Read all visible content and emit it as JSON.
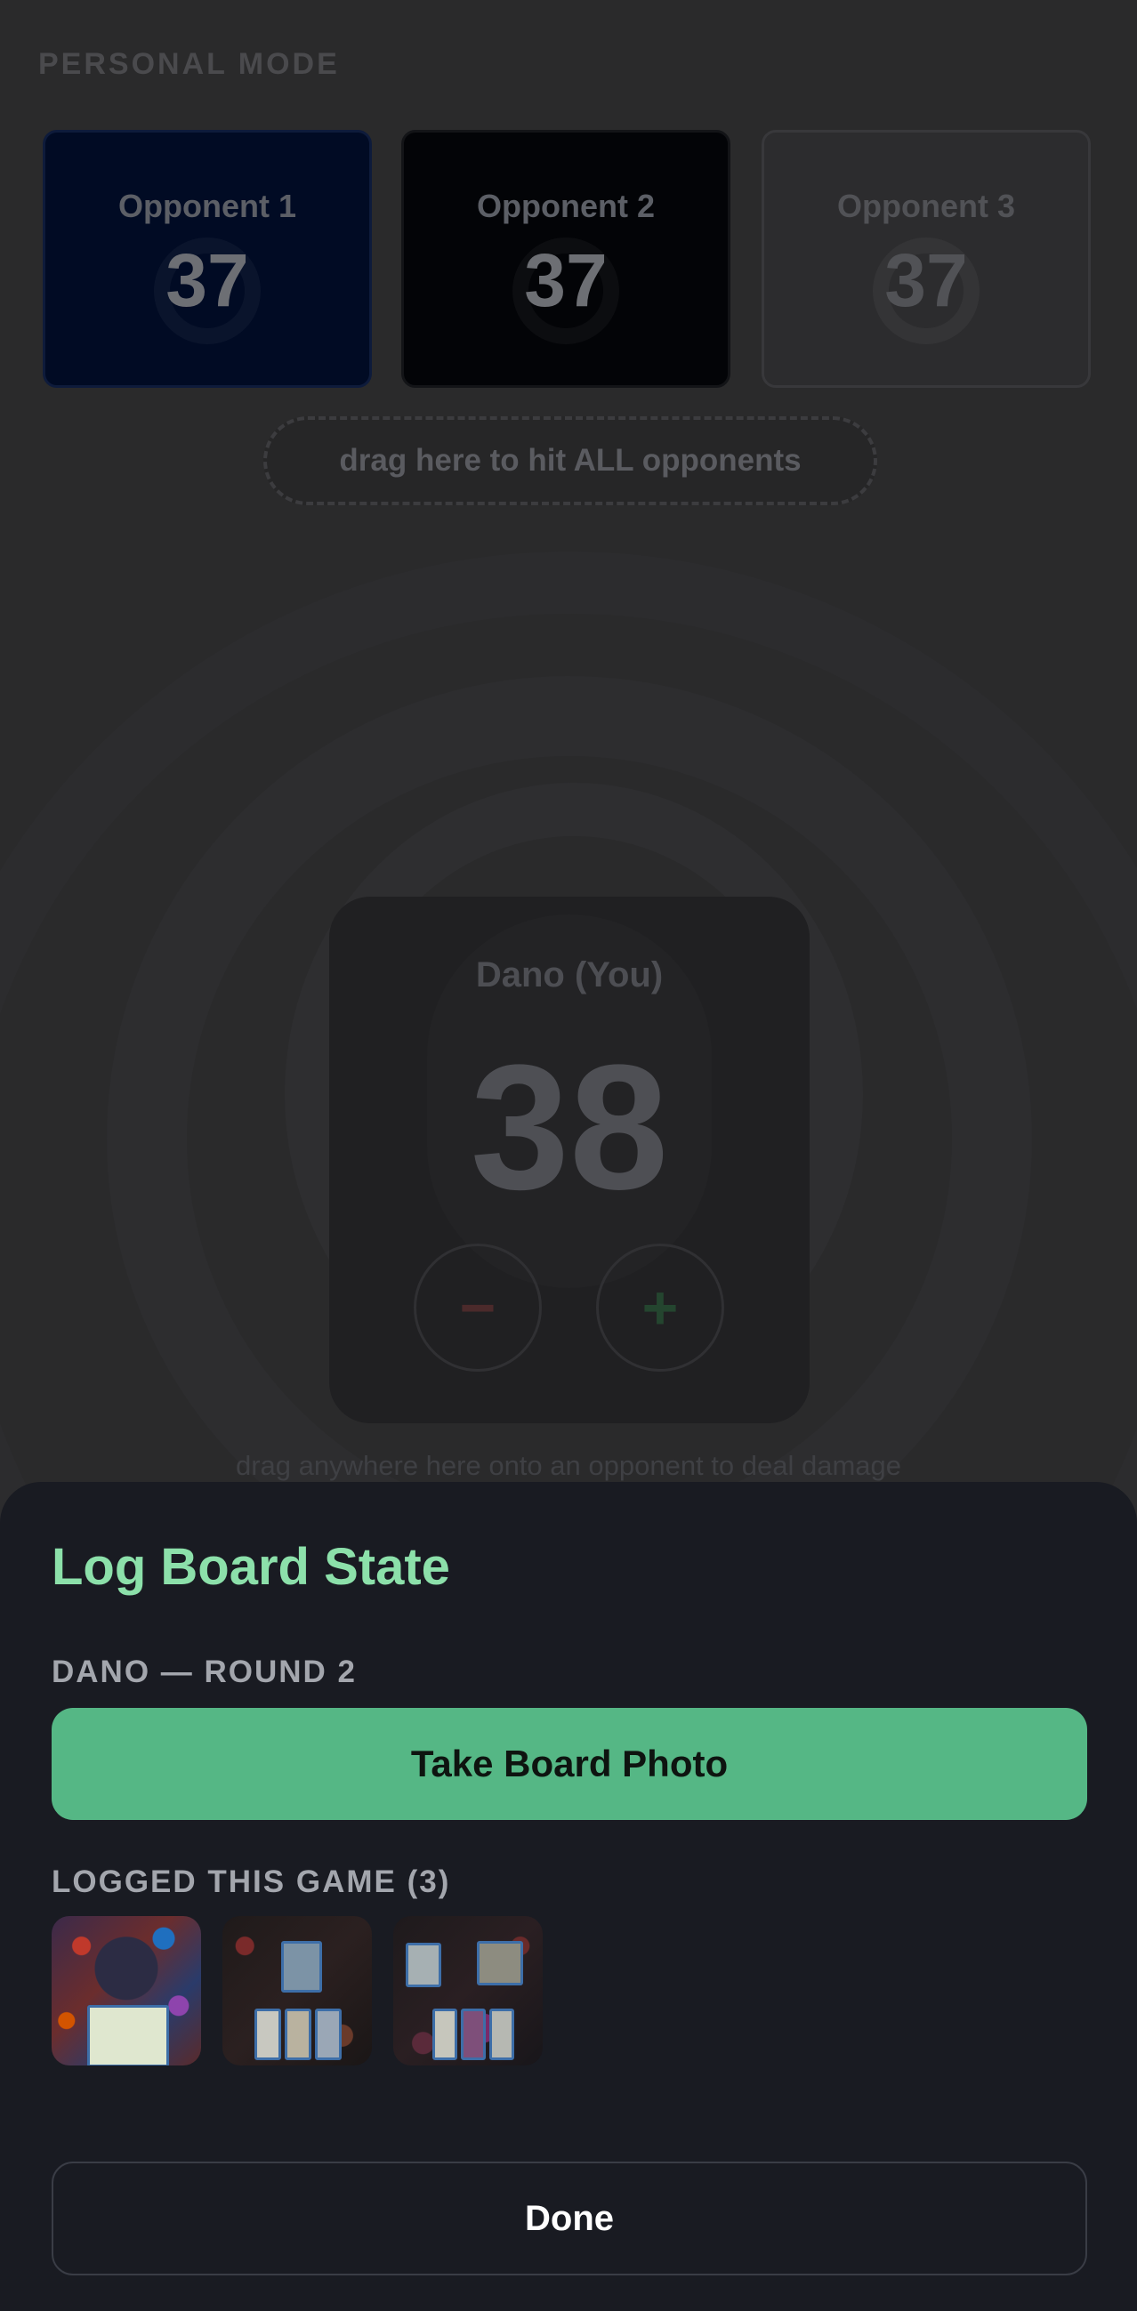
{
  "background": {
    "mode_label": "PERSONAL MODE",
    "opponents": [
      {
        "name": "Opponent 1",
        "life": "37",
        "color": "#010b24"
      },
      {
        "name": "Opponent 2",
        "life": "37",
        "color": "#030407"
      },
      {
        "name": "Opponent 3",
        "life": "37",
        "color": "#2c2c2e"
      }
    ],
    "hit_all_label": "drag here to hit ALL opponents",
    "player": {
      "name": "Dano (You)",
      "life": "38",
      "minus_label": "−",
      "plus_label": "+"
    },
    "drag_hint": "drag anywhere here onto an opponent to deal damage"
  },
  "sheet": {
    "title": "Log Board State",
    "round_label": "DANO — ROUND 2",
    "take_photo_label": "Take Board Photo",
    "logged_label": "LOGGED THIS GAME (3)",
    "done_label": "Done",
    "accent_color": "#55b785",
    "title_color": "#8ce0aa"
  }
}
